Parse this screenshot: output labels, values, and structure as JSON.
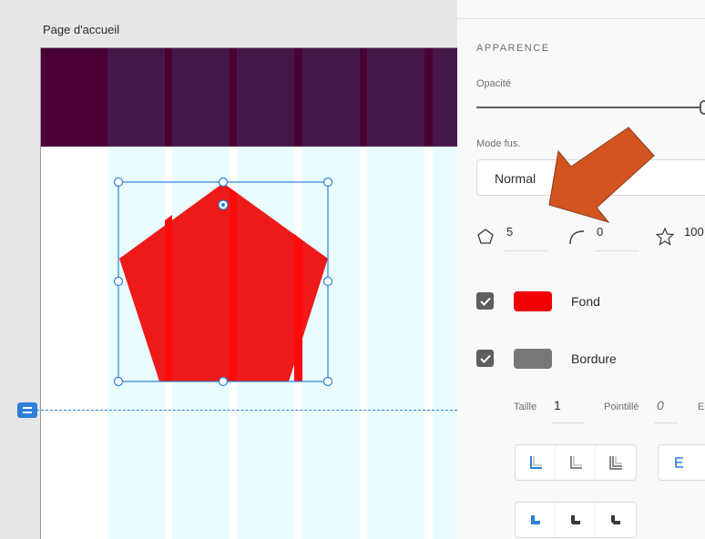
{
  "canvas": {
    "artboard_title": "Page d'accueil",
    "colors": {
      "header": "#4a0034",
      "column_header": "#46184a",
      "column_guide": "#e9fdff",
      "shape_fill": "#ee1a1a",
      "selection": "#2e7fd8",
      "annotation_arrow": "#d3541f"
    }
  },
  "panel": {
    "section_title": "APPARENCE",
    "opacity_label": "Opacité",
    "blend_label": "Mode fus.",
    "blend_value": "Normal",
    "polygon": {
      "corners_value": "5",
      "radius_value": "0",
      "star_ratio_value": "100"
    },
    "fill": {
      "checked": true,
      "color": "#f00000",
      "label": "Fond"
    },
    "border": {
      "checked": true,
      "color": "#777777",
      "label": "Bordure"
    },
    "stroke": {
      "size_label": "Taille",
      "size_value": "1",
      "dash_label": "Pointillé",
      "dash_value": "0",
      "spacing_label": "Es"
    },
    "icons": {
      "stroke_position": [
        "stroke-inner-icon",
        "stroke-outer-icon",
        "stroke-center-icon"
      ],
      "line_cap": [
        "cap-icon"
      ],
      "line_join": [
        "join-miter-icon",
        "join-round-icon",
        "join-bevel-icon"
      ]
    }
  }
}
